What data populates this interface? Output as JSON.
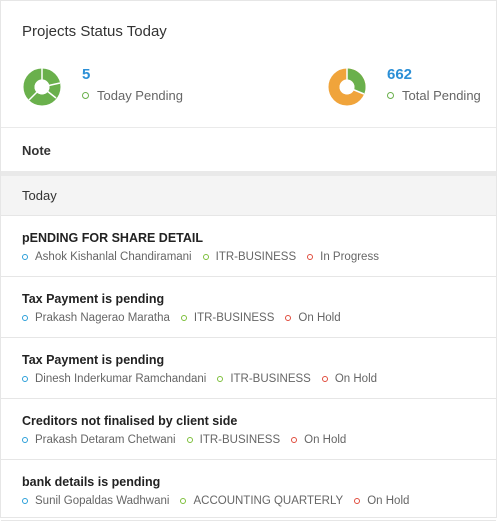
{
  "header": {
    "title": "Projects Status Today"
  },
  "stats": [
    {
      "value": "5",
      "label": "Today Pending",
      "value_color": "#2b8fd6",
      "dot_color": "#6ab04c",
      "donut": [
        "#6ab04c"
      ]
    },
    {
      "value": "662",
      "label": "Total Pending",
      "value_color": "#2b8fd6",
      "dot_color": "#6ab04c",
      "donut": [
        "#f0a43b",
        "#6ab04c"
      ]
    }
  ],
  "note_label": "Note",
  "today_label": "Today",
  "colors": {
    "client": "#2b9fd9",
    "type": "#7cbf3a",
    "status": "#e04b3c"
  },
  "items": [
    {
      "title": "pENDING FOR SHARE DETAIL",
      "client": "Ashok Kishanlal Chandiramani",
      "type": "ITR-BUSINESS",
      "status": "In Progress"
    },
    {
      "title": "Tax Payment is pending",
      "client": "Prakash Nagerao Maratha",
      "type": "ITR-BUSINESS",
      "status": "On Hold"
    },
    {
      "title": "Tax Payment is pending",
      "client": "Dinesh Inderkumar Ramchandani",
      "type": "ITR-BUSINESS",
      "status": "On Hold"
    },
    {
      "title": "Creditors not finalised by client side",
      "client": "Prakash Detaram Chetwani",
      "type": "ITR-BUSINESS",
      "status": "On Hold"
    },
    {
      "title": "bank details is pending",
      "client": "Sunil Gopaldas Wadhwani",
      "type": "ACCOUNTING QUARTERLY",
      "status": "On Hold"
    }
  ]
}
